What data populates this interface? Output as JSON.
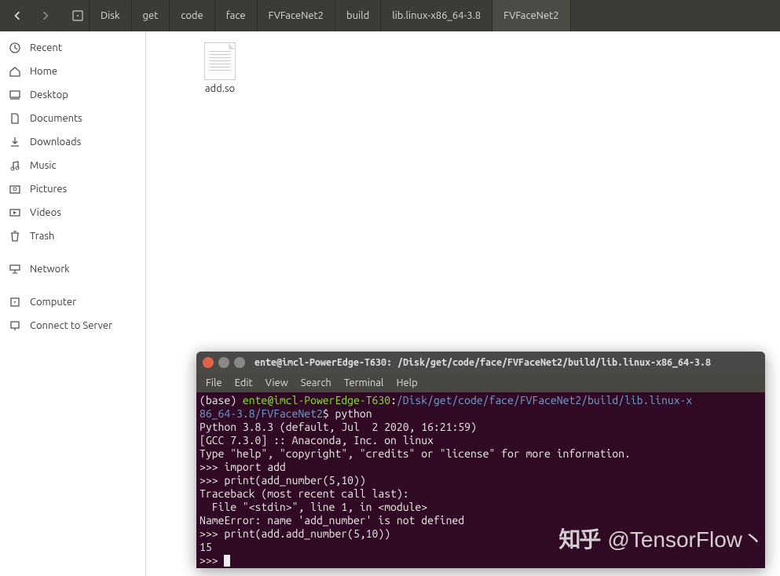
{
  "nav": {
    "back": "‹",
    "forward": "›"
  },
  "breadcrumb": {
    "items": [
      {
        "label": "Disk"
      },
      {
        "label": "get"
      },
      {
        "label": "code"
      },
      {
        "label": "face"
      },
      {
        "label": "FVFaceNet2"
      },
      {
        "label": "build"
      },
      {
        "label": "lib.linux-x86_64-3.8"
      },
      {
        "label": "FVFaceNet2"
      }
    ]
  },
  "sidebar": {
    "items": [
      {
        "label": "Recent",
        "icon": "clock-icon"
      },
      {
        "label": "Home",
        "icon": "home-icon"
      },
      {
        "label": "Desktop",
        "icon": "desktop-icon"
      },
      {
        "label": "Documents",
        "icon": "documents-icon"
      },
      {
        "label": "Downloads",
        "icon": "downloads-icon"
      },
      {
        "label": "Music",
        "icon": "music-icon"
      },
      {
        "label": "Pictures",
        "icon": "pictures-icon"
      },
      {
        "label": "Videos",
        "icon": "videos-icon"
      },
      {
        "label": "Trash",
        "icon": "trash-icon"
      }
    ],
    "items2": [
      {
        "label": "Network",
        "icon": "network-icon"
      }
    ],
    "items3": [
      {
        "label": "Computer",
        "icon": "computer-icon"
      },
      {
        "label": "Connect to Server",
        "icon": "server-icon"
      }
    ]
  },
  "file": {
    "name": "add.so"
  },
  "terminal": {
    "title": "ente@imcl-PowerEdge-T630: /Disk/get/code/face/FVFaceNet2/build/lib.linux-x86_64-3.8",
    "menus": [
      "File",
      "Edit",
      "View",
      "Search",
      "Terminal",
      "Help"
    ],
    "prompt_env": "(base) ",
    "prompt_user": "ente@imcl-PowerEdge-T630",
    "prompt_sep": ":",
    "prompt_path1": "/Disk/get/code/face/FVFaceNet2/build/lib.linux-x",
    "prompt_path2": "86_64-3.8/FVFaceNet2",
    "prompt_dollar": "$ ",
    "cmd1": "python",
    "out1": "Python 3.8.3 (default, Jul  2 2020, 16:21:59)",
    "out2": "[GCC 7.3.0] :: Anaconda, Inc. on linux",
    "out3": "Type \"help\", \"copyright\", \"credits\" or \"license\" for more information.",
    "ps": ">>> ",
    "cmd2": "import add",
    "cmd3": "print(add_number(5,10))",
    "err1": "Traceback (most recent call last):",
    "err2": "  File \"<stdin>\", line 1, in <module>",
    "err3": "NameError: name 'add_number' is not defined",
    "cmd4": "print(add.add_number(5,10))",
    "res": "15"
  },
  "watermark": {
    "logo": "知乎",
    "handle": "@TensorFlow丶"
  }
}
